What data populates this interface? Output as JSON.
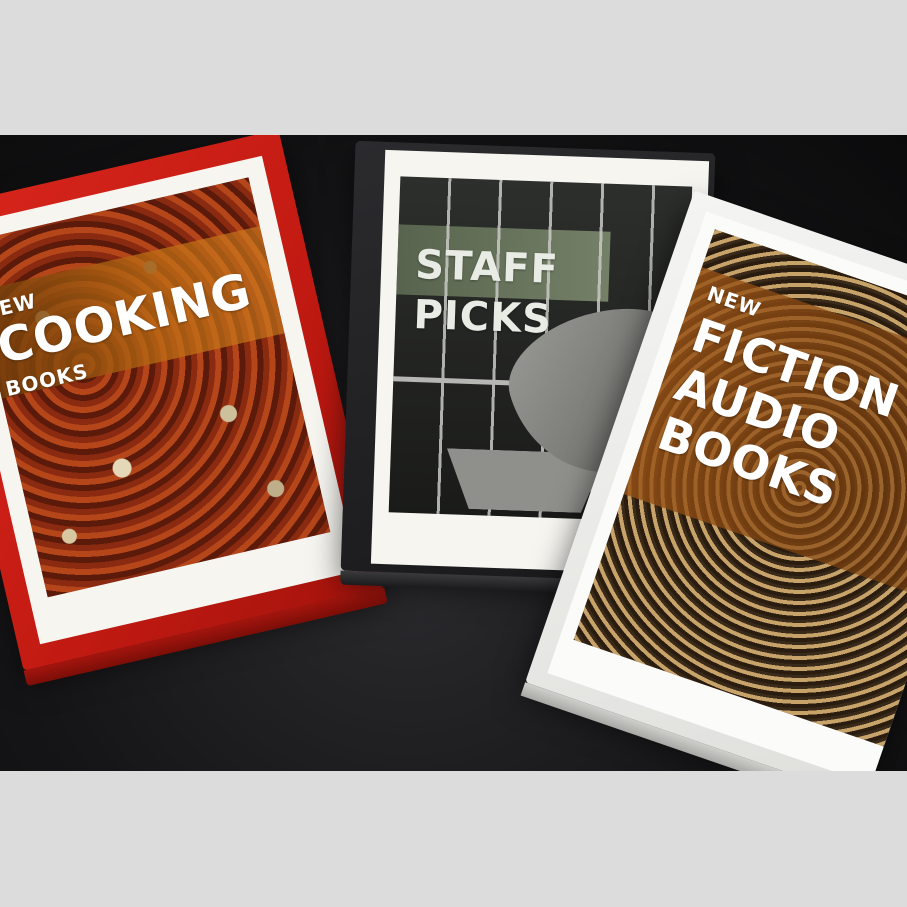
{
  "image": {
    "background_color": "#dcdcdc",
    "surface_color": "#151517"
  },
  "binders": [
    {
      "color": "#c21a12",
      "lines": [
        "NEW",
        "COOKING",
        "BOOKS"
      ]
    },
    {
      "color": "#1f1f21",
      "lines": [
        "STAFF",
        "PICKS"
      ]
    },
    {
      "color": "#eeeeec",
      "lines": [
        "NEW",
        "FICTION",
        "AUDIO",
        "BOOKS"
      ]
    }
  ]
}
